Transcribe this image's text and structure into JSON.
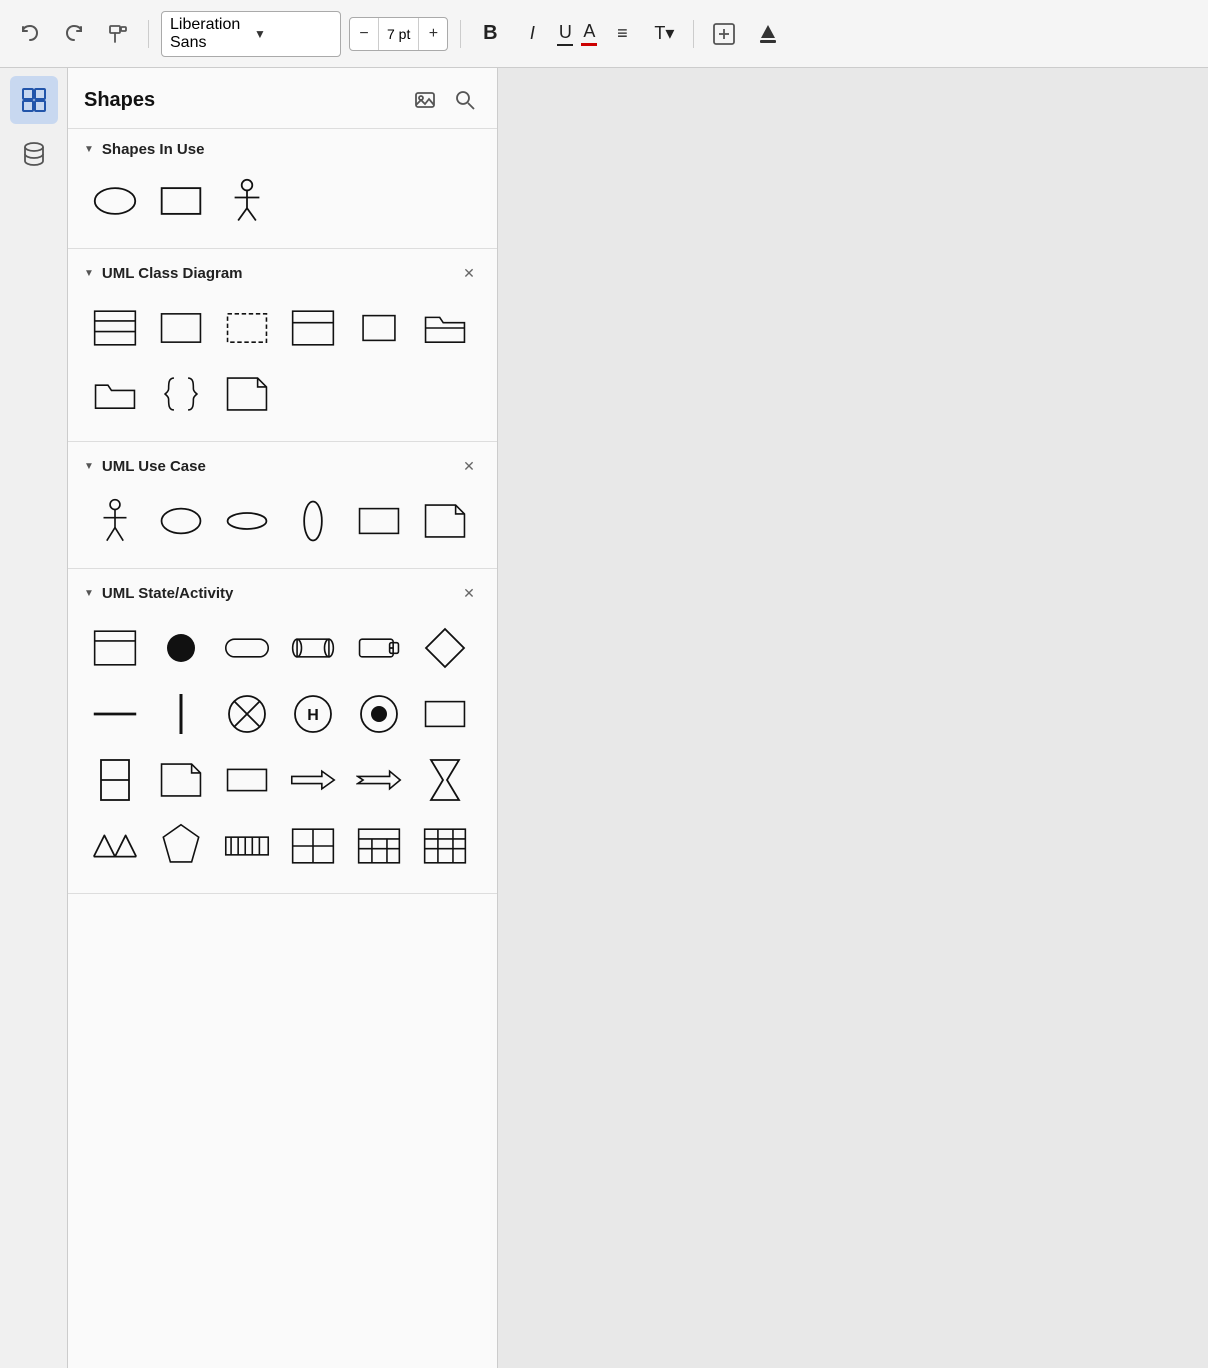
{
  "toolbar": {
    "font_name": "Liberation Sans",
    "font_size": "7 pt",
    "minus_label": "−",
    "plus_label": "+",
    "bold_label": "B",
    "italic_label": "I",
    "underline_label": "U",
    "color_label": "A",
    "align_label": "≡",
    "text_label": "T▾",
    "undo_title": "Undo",
    "redo_title": "Redo",
    "format_paint_title": "Format Painter"
  },
  "panel": {
    "title": "Shapes",
    "image_icon_title": "Image",
    "search_icon_title": "Search"
  },
  "sections": [
    {
      "id": "shapes-in-use",
      "title": "Shapes In Use",
      "has_close": false,
      "shapes": [
        "ellipse",
        "rectangle",
        "actor"
      ]
    },
    {
      "id": "uml-class-diagram",
      "title": "UML Class Diagram",
      "has_close": true,
      "shapes": [
        "class-table",
        "rect-plain",
        "rect-dashed",
        "class-table2",
        "rect-small",
        "folder-tab",
        "folder-open",
        "curly-braces",
        "note"
      ]
    },
    {
      "id": "uml-use-case",
      "title": "UML Use Case",
      "has_close": true,
      "shapes": [
        "actor",
        "ellipse",
        "ellipse-flat",
        "ellipse-tall",
        "rect-plain",
        "note"
      ]
    },
    {
      "id": "uml-state-activity",
      "title": "UML State/Activity",
      "has_close": true,
      "shapes": [
        "frame",
        "filled-circle",
        "rounded-rect",
        "cylinder-h",
        "cylinder-h2",
        "diamond",
        "h-line",
        "v-line",
        "circle-x",
        "circle-h",
        "circle-dot",
        "rect-plain",
        "rect-split-v",
        "note",
        "rect-plain2",
        "arrow-right",
        "arrow-notch",
        "hourglass",
        "zigzag",
        "pentagon",
        "barred-rect",
        "grid2",
        "grid3",
        "grid4"
      ]
    }
  ]
}
